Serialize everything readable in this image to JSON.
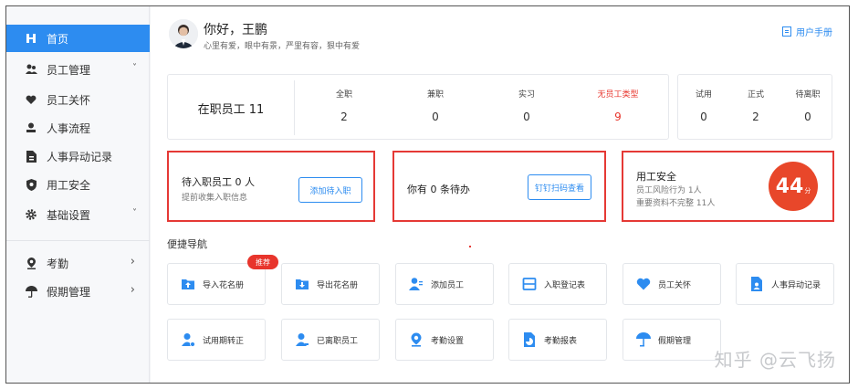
{
  "sidebar": {
    "items": [
      {
        "label": "首页",
        "icon": "home-icon",
        "active": true
      },
      {
        "label": "员工管理",
        "icon": "users-icon",
        "expandable": true
      },
      {
        "label": "员工关怀",
        "icon": "heart-icon"
      },
      {
        "label": "人事流程",
        "icon": "user-flow-icon"
      },
      {
        "label": "人事异动记录",
        "icon": "document-icon"
      },
      {
        "label": "用工安全",
        "icon": "shield-icon"
      },
      {
        "label": "基础设置",
        "icon": "gear-icon",
        "expandable": true
      },
      {
        "label": "考勤",
        "icon": "location-icon",
        "arrow": true
      },
      {
        "label": "假期管理",
        "icon": "umbrella-icon",
        "arrow": true
      }
    ],
    "chevron": "˅",
    "arrow": "›"
  },
  "header": {
    "greeting": "你好，王鹏",
    "motto": "心里有爱，眼中有景，严里有容，狠中有爱",
    "manual": "用户手册"
  },
  "stats": {
    "total_label": "在职员工  11",
    "items": [
      {
        "label": "全职",
        "value": "2"
      },
      {
        "label": "兼职",
        "value": "0"
      },
      {
        "label": "实习",
        "value": "0"
      },
      {
        "label": "无员工类型",
        "value": "9"
      }
    ],
    "items2": [
      {
        "label": "试用",
        "value": "0"
      },
      {
        "label": "正式",
        "value": "2"
      },
      {
        "label": "待离职",
        "value": "0"
      }
    ]
  },
  "cards": {
    "pending": {
      "title": "待入职员工 0 人",
      "subtitle": "提前收集入职信息",
      "button": "添加待入职"
    },
    "todo": {
      "title": "你有 0 条待办",
      "button": "钉钉扫码查看"
    },
    "safety": {
      "title": "用工安全",
      "line1": "员工风险行为 1人",
      "line2": "重要资料不完整 11人",
      "score": "44",
      "score_unit": "分"
    }
  },
  "quick_nav": {
    "title": "便捷导航",
    "badge": "推荐",
    "tiles": [
      {
        "label": "导入花名册",
        "icon": "import-icon"
      },
      {
        "label": "导出花名册",
        "icon": "export-icon"
      },
      {
        "label": "添加员工",
        "icon": "add-user-icon"
      },
      {
        "label": "入职登记表",
        "icon": "form-icon"
      },
      {
        "label": "员工关怀",
        "icon": "heart-icon"
      },
      {
        "label": "人事异动记录",
        "icon": "document-icon"
      },
      {
        "label": "试用期转正",
        "icon": "user-check-icon"
      },
      {
        "label": "已离职员工",
        "icon": "user-leave-icon"
      },
      {
        "label": "考勤设置",
        "icon": "location-icon"
      },
      {
        "label": "考勤报表",
        "icon": "report-icon"
      },
      {
        "label": "假期管理",
        "icon": "umbrella-icon"
      }
    ]
  },
  "watermark": "知乎 @云飞扬",
  "colors": {
    "accent": "#2d8cf0",
    "alert": "#e53935",
    "score_bg": "#e8472a"
  }
}
